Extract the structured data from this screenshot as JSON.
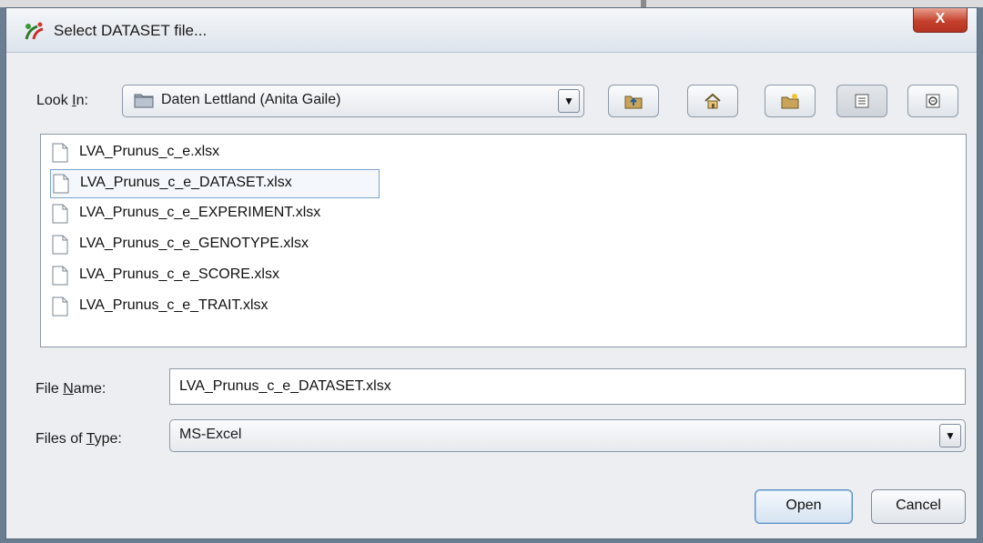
{
  "window": {
    "title": "Select DATASET file...",
    "close_label": "X"
  },
  "look_in": {
    "label_pre": "Look ",
    "label_mnemonic": "I",
    "label_post": "n:",
    "value": "Daten Lettland (Anita Gaile)"
  },
  "toolbar": {
    "icons": [
      "up-folder-icon",
      "home-icon",
      "new-folder-icon",
      "list-view-icon",
      "details-view-icon"
    ]
  },
  "files": [
    {
      "name": "LVA_Prunus_c_e.xlsx",
      "selected": false
    },
    {
      "name": "LVA_Prunus_c_e_DATASET.xlsx",
      "selected": true
    },
    {
      "name": "LVA_Prunus_c_e_EXPERIMENT.xlsx",
      "selected": false
    },
    {
      "name": "LVA_Prunus_c_e_GENOTYPE.xlsx",
      "selected": false
    },
    {
      "name": "LVA_Prunus_c_e_SCORE.xlsx",
      "selected": false
    },
    {
      "name": "LVA_Prunus_c_e_TRAIT.xlsx",
      "selected": false
    }
  ],
  "file_name": {
    "label_pre": "File ",
    "label_mnemonic": "N",
    "label_post": "ame:",
    "value": "LVA_Prunus_c_e_DATASET.xlsx"
  },
  "file_type": {
    "label_pre": "Files of ",
    "label_mnemonic": "T",
    "label_post": "ype:",
    "value": "MS-Excel"
  },
  "buttons": {
    "open": "Open",
    "cancel": "Cancel"
  },
  "colors": {
    "accent": "#5d8fc4",
    "close_red": "#c4402c",
    "selection": "#7fa3c9"
  }
}
